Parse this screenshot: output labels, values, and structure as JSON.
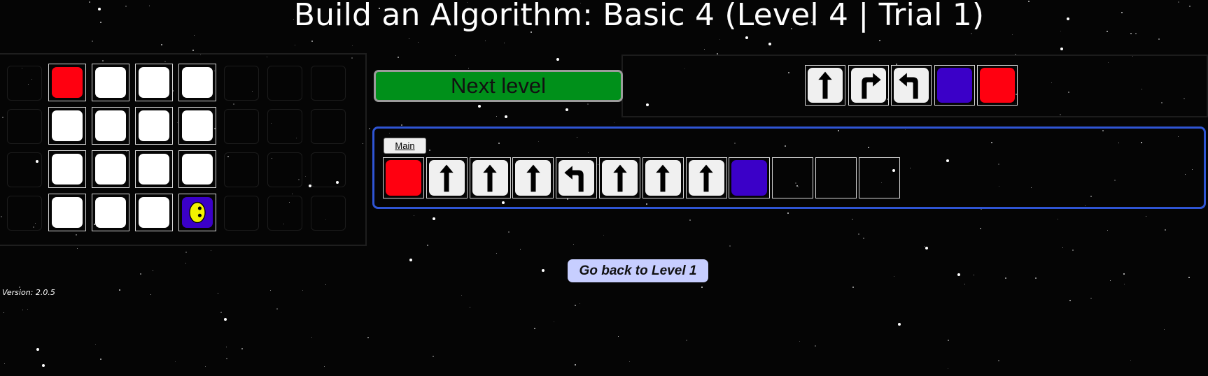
{
  "title": "Build an Algorithm: Basic 4 (Level 4 | Trial 1)",
  "next_level_label": "Next level",
  "main_tab_label": "Main",
  "go_back_label": "Go back to Level 1",
  "version": "Version: 2.0.5",
  "colors": {
    "background": "#050505",
    "red": "#ff0010",
    "blue": "#3b00c8",
    "green_button": "#00901a",
    "program_border": "#2f55d4",
    "go_back_bg": "#c7ceff",
    "face": "#f2f200"
  },
  "board": {
    "rows": 4,
    "cols": 8,
    "cells": [
      [
        "empty",
        "red",
        "white",
        "white",
        "white",
        "empty",
        "empty",
        "empty"
      ],
      [
        "empty",
        "white",
        "white",
        "white",
        "white",
        "empty",
        "empty",
        "empty"
      ],
      [
        "empty",
        "white",
        "white",
        "white",
        "white",
        "empty",
        "empty",
        "empty"
      ],
      [
        "empty",
        "white",
        "white",
        "white",
        "robot",
        "empty",
        "empty",
        "empty"
      ]
    ]
  },
  "palette": [
    "forward-arrow",
    "turn-right-arrow",
    "turn-left-arrow",
    "blue-paint",
    "red-paint"
  ],
  "program_slots": [
    "red-paint",
    "forward-arrow",
    "forward-arrow",
    "forward-arrow",
    "turn-left-arrow",
    "forward-arrow",
    "forward-arrow",
    "forward-arrow",
    "blue-paint",
    "empty",
    "empty",
    "empty"
  ]
}
